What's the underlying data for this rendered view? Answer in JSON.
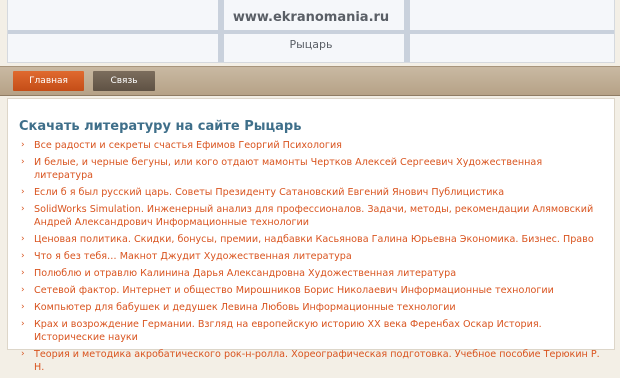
{
  "header": {
    "site_url": "www.ekranomania.ru",
    "site_name": "Рыцарь"
  },
  "nav": {
    "items": [
      {
        "label": "Главная",
        "active": true
      },
      {
        "label": "Связь",
        "active": false
      }
    ]
  },
  "main": {
    "title": "Скачать литературу на сайте Рыцарь",
    "bullet_icon": "chevron-right-icon",
    "links": [
      "Все радости и секреты счастья Ефимов Георгий Психология",
      "И белые, и черные бегуны, или кого отдают мамонты Чертков Алексей Сергеевич Художественная литература",
      "Если б я был русский царь. Советы Президенту Сатановский Евгений Янович Публицистика",
      "SolidWorks Simulation. Инженерный анализ для профессионалов. Задачи, методы, рекомендации Алямовский Андрей Александрович Информационные технологии",
      "Ценовая политика. Скидки, бонусы, премии, надбавки Касьянова Галина Юрьевна Экономика. Бизнес. Право",
      "Что я без тебя… Макнот Джудит Художественная литература",
      "Полюблю и отравлю Калинина Дарья Александровна Художественная литература",
      "Сетевой фактор. Интернет и общество Мирошников Борис Николаевич Информационные технологии",
      "Компьютер для бабушек и дедушек Левина Любовь Информационные технологии",
      "Крах и возрождение Германии. Взгляд на европейскую историю ХХ века Ференбах Оскар История. Исторические науки",
      "Теория и методика акробатического рок-н-ролла. Хореографическая подготовка. Учебное пособие Терюкин Р. Н."
    ]
  },
  "colors": {
    "accent": "#d9541f",
    "title": "#3f6f8a",
    "nav_active": "#d2561f",
    "nav_inactive": "#6c5f50"
  }
}
